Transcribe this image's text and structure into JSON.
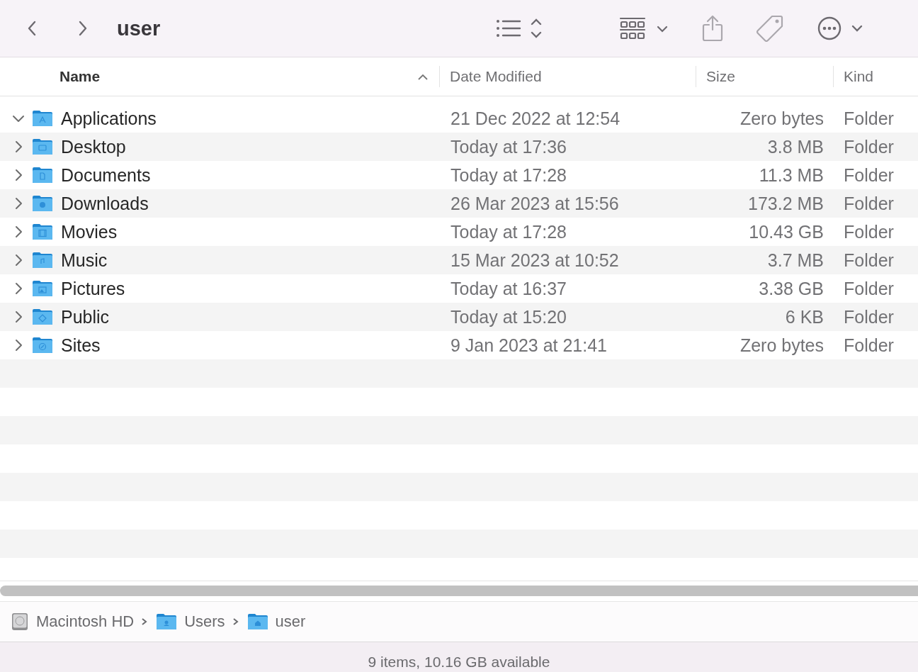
{
  "toolbar": {
    "title": "user",
    "items": [
      {
        "kind": "back",
        "disabled": false
      },
      {
        "kind": "forward",
        "disabled": false
      },
      {
        "kind": "list-view",
        "disabled": false
      },
      {
        "kind": "group",
        "disabled": false
      },
      {
        "kind": "share",
        "disabled": true
      },
      {
        "kind": "tag",
        "disabled": true
      },
      {
        "kind": "more",
        "disabled": false
      }
    ]
  },
  "columns": [
    {
      "label": "Name",
      "sorted": true
    },
    {
      "label": "Date Modified",
      "sorted": false
    },
    {
      "label": "Size",
      "sorted": false
    },
    {
      "label": "Kind",
      "sorted": false
    }
  ],
  "rows": [
    {
      "name": "Applications",
      "date": "21 Dec 2022 at 12:54",
      "size": "Zero bytes",
      "file_kind": "Folder",
      "expanded": true,
      "kind": "apps"
    },
    {
      "name": "Desktop",
      "date": "Today at 17:36",
      "size": "3.8 MB",
      "file_kind": "Folder",
      "expanded": false,
      "kind": "desktop"
    },
    {
      "name": "Documents",
      "date": "Today at 17:28",
      "size": "11.3 MB",
      "file_kind": "Folder",
      "expanded": false,
      "kind": "document"
    },
    {
      "name": "Downloads",
      "date": "26 Mar 2023 at 15:56",
      "size": "173.2 MB",
      "file_kind": "Folder",
      "expanded": false,
      "kind": "download"
    },
    {
      "name": "Movies",
      "date": "Today at 17:28",
      "size": "10.43 GB",
      "file_kind": "Folder",
      "expanded": false,
      "kind": "film"
    },
    {
      "name": "Music",
      "date": "15 Mar 2023 at 10:52",
      "size": "3.7 MB",
      "file_kind": "Folder",
      "expanded": false,
      "kind": "music"
    },
    {
      "name": "Pictures",
      "date": "Today at 16:37",
      "size": "3.38 GB",
      "file_kind": "Folder",
      "expanded": false,
      "kind": "picture"
    },
    {
      "name": "Public",
      "date": "Today at 15:20",
      "size": "6 KB",
      "file_kind": "Folder",
      "expanded": false,
      "kind": "public"
    },
    {
      "name": "Sites",
      "date": "9 Jan 2023 at 21:41",
      "size": "Zero bytes",
      "file_kind": "Folder",
      "expanded": false,
      "kind": "compass"
    }
  ],
  "path": [
    {
      "label": "Macintosh HD",
      "kind": "disk"
    },
    {
      "label": "Users",
      "kind": "users"
    },
    {
      "label": "user",
      "kind": "home"
    }
  ],
  "status": "9 items, 10.16 GB available"
}
